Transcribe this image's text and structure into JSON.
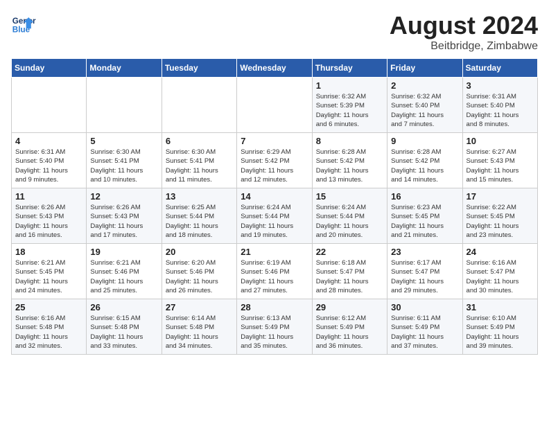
{
  "header": {
    "logo_line1": "General",
    "logo_line2": "Blue",
    "month_year": "August 2024",
    "location": "Beitbridge, Zimbabwe"
  },
  "days_of_week": [
    "Sunday",
    "Monday",
    "Tuesday",
    "Wednesday",
    "Thursday",
    "Friday",
    "Saturday"
  ],
  "weeks": [
    [
      {
        "day": "",
        "info": ""
      },
      {
        "day": "",
        "info": ""
      },
      {
        "day": "",
        "info": ""
      },
      {
        "day": "",
        "info": ""
      },
      {
        "day": "1",
        "info": "Sunrise: 6:32 AM\nSunset: 5:39 PM\nDaylight: 11 hours\nand 6 minutes."
      },
      {
        "day": "2",
        "info": "Sunrise: 6:32 AM\nSunset: 5:40 PM\nDaylight: 11 hours\nand 7 minutes."
      },
      {
        "day": "3",
        "info": "Sunrise: 6:31 AM\nSunset: 5:40 PM\nDaylight: 11 hours\nand 8 minutes."
      }
    ],
    [
      {
        "day": "4",
        "info": "Sunrise: 6:31 AM\nSunset: 5:40 PM\nDaylight: 11 hours\nand 9 minutes."
      },
      {
        "day": "5",
        "info": "Sunrise: 6:30 AM\nSunset: 5:41 PM\nDaylight: 11 hours\nand 10 minutes."
      },
      {
        "day": "6",
        "info": "Sunrise: 6:30 AM\nSunset: 5:41 PM\nDaylight: 11 hours\nand 11 minutes."
      },
      {
        "day": "7",
        "info": "Sunrise: 6:29 AM\nSunset: 5:42 PM\nDaylight: 11 hours\nand 12 minutes."
      },
      {
        "day": "8",
        "info": "Sunrise: 6:28 AM\nSunset: 5:42 PM\nDaylight: 11 hours\nand 13 minutes."
      },
      {
        "day": "9",
        "info": "Sunrise: 6:28 AM\nSunset: 5:42 PM\nDaylight: 11 hours\nand 14 minutes."
      },
      {
        "day": "10",
        "info": "Sunrise: 6:27 AM\nSunset: 5:43 PM\nDaylight: 11 hours\nand 15 minutes."
      }
    ],
    [
      {
        "day": "11",
        "info": "Sunrise: 6:26 AM\nSunset: 5:43 PM\nDaylight: 11 hours\nand 16 minutes."
      },
      {
        "day": "12",
        "info": "Sunrise: 6:26 AM\nSunset: 5:43 PM\nDaylight: 11 hours\nand 17 minutes."
      },
      {
        "day": "13",
        "info": "Sunrise: 6:25 AM\nSunset: 5:44 PM\nDaylight: 11 hours\nand 18 minutes."
      },
      {
        "day": "14",
        "info": "Sunrise: 6:24 AM\nSunset: 5:44 PM\nDaylight: 11 hours\nand 19 minutes."
      },
      {
        "day": "15",
        "info": "Sunrise: 6:24 AM\nSunset: 5:44 PM\nDaylight: 11 hours\nand 20 minutes."
      },
      {
        "day": "16",
        "info": "Sunrise: 6:23 AM\nSunset: 5:45 PM\nDaylight: 11 hours\nand 21 minutes."
      },
      {
        "day": "17",
        "info": "Sunrise: 6:22 AM\nSunset: 5:45 PM\nDaylight: 11 hours\nand 23 minutes."
      }
    ],
    [
      {
        "day": "18",
        "info": "Sunrise: 6:21 AM\nSunset: 5:45 PM\nDaylight: 11 hours\nand 24 minutes."
      },
      {
        "day": "19",
        "info": "Sunrise: 6:21 AM\nSunset: 5:46 PM\nDaylight: 11 hours\nand 25 minutes."
      },
      {
        "day": "20",
        "info": "Sunrise: 6:20 AM\nSunset: 5:46 PM\nDaylight: 11 hours\nand 26 minutes."
      },
      {
        "day": "21",
        "info": "Sunrise: 6:19 AM\nSunset: 5:46 PM\nDaylight: 11 hours\nand 27 minutes."
      },
      {
        "day": "22",
        "info": "Sunrise: 6:18 AM\nSunset: 5:47 PM\nDaylight: 11 hours\nand 28 minutes."
      },
      {
        "day": "23",
        "info": "Sunrise: 6:17 AM\nSunset: 5:47 PM\nDaylight: 11 hours\nand 29 minutes."
      },
      {
        "day": "24",
        "info": "Sunrise: 6:16 AM\nSunset: 5:47 PM\nDaylight: 11 hours\nand 30 minutes."
      }
    ],
    [
      {
        "day": "25",
        "info": "Sunrise: 6:16 AM\nSunset: 5:48 PM\nDaylight: 11 hours\nand 32 minutes."
      },
      {
        "day": "26",
        "info": "Sunrise: 6:15 AM\nSunset: 5:48 PM\nDaylight: 11 hours\nand 33 minutes."
      },
      {
        "day": "27",
        "info": "Sunrise: 6:14 AM\nSunset: 5:48 PM\nDaylight: 11 hours\nand 34 minutes."
      },
      {
        "day": "28",
        "info": "Sunrise: 6:13 AM\nSunset: 5:49 PM\nDaylight: 11 hours\nand 35 minutes."
      },
      {
        "day": "29",
        "info": "Sunrise: 6:12 AM\nSunset: 5:49 PM\nDaylight: 11 hours\nand 36 minutes."
      },
      {
        "day": "30",
        "info": "Sunrise: 6:11 AM\nSunset: 5:49 PM\nDaylight: 11 hours\nand 37 minutes."
      },
      {
        "day": "31",
        "info": "Sunrise: 6:10 AM\nSunset: 5:49 PM\nDaylight: 11 hours\nand 39 minutes."
      }
    ]
  ]
}
